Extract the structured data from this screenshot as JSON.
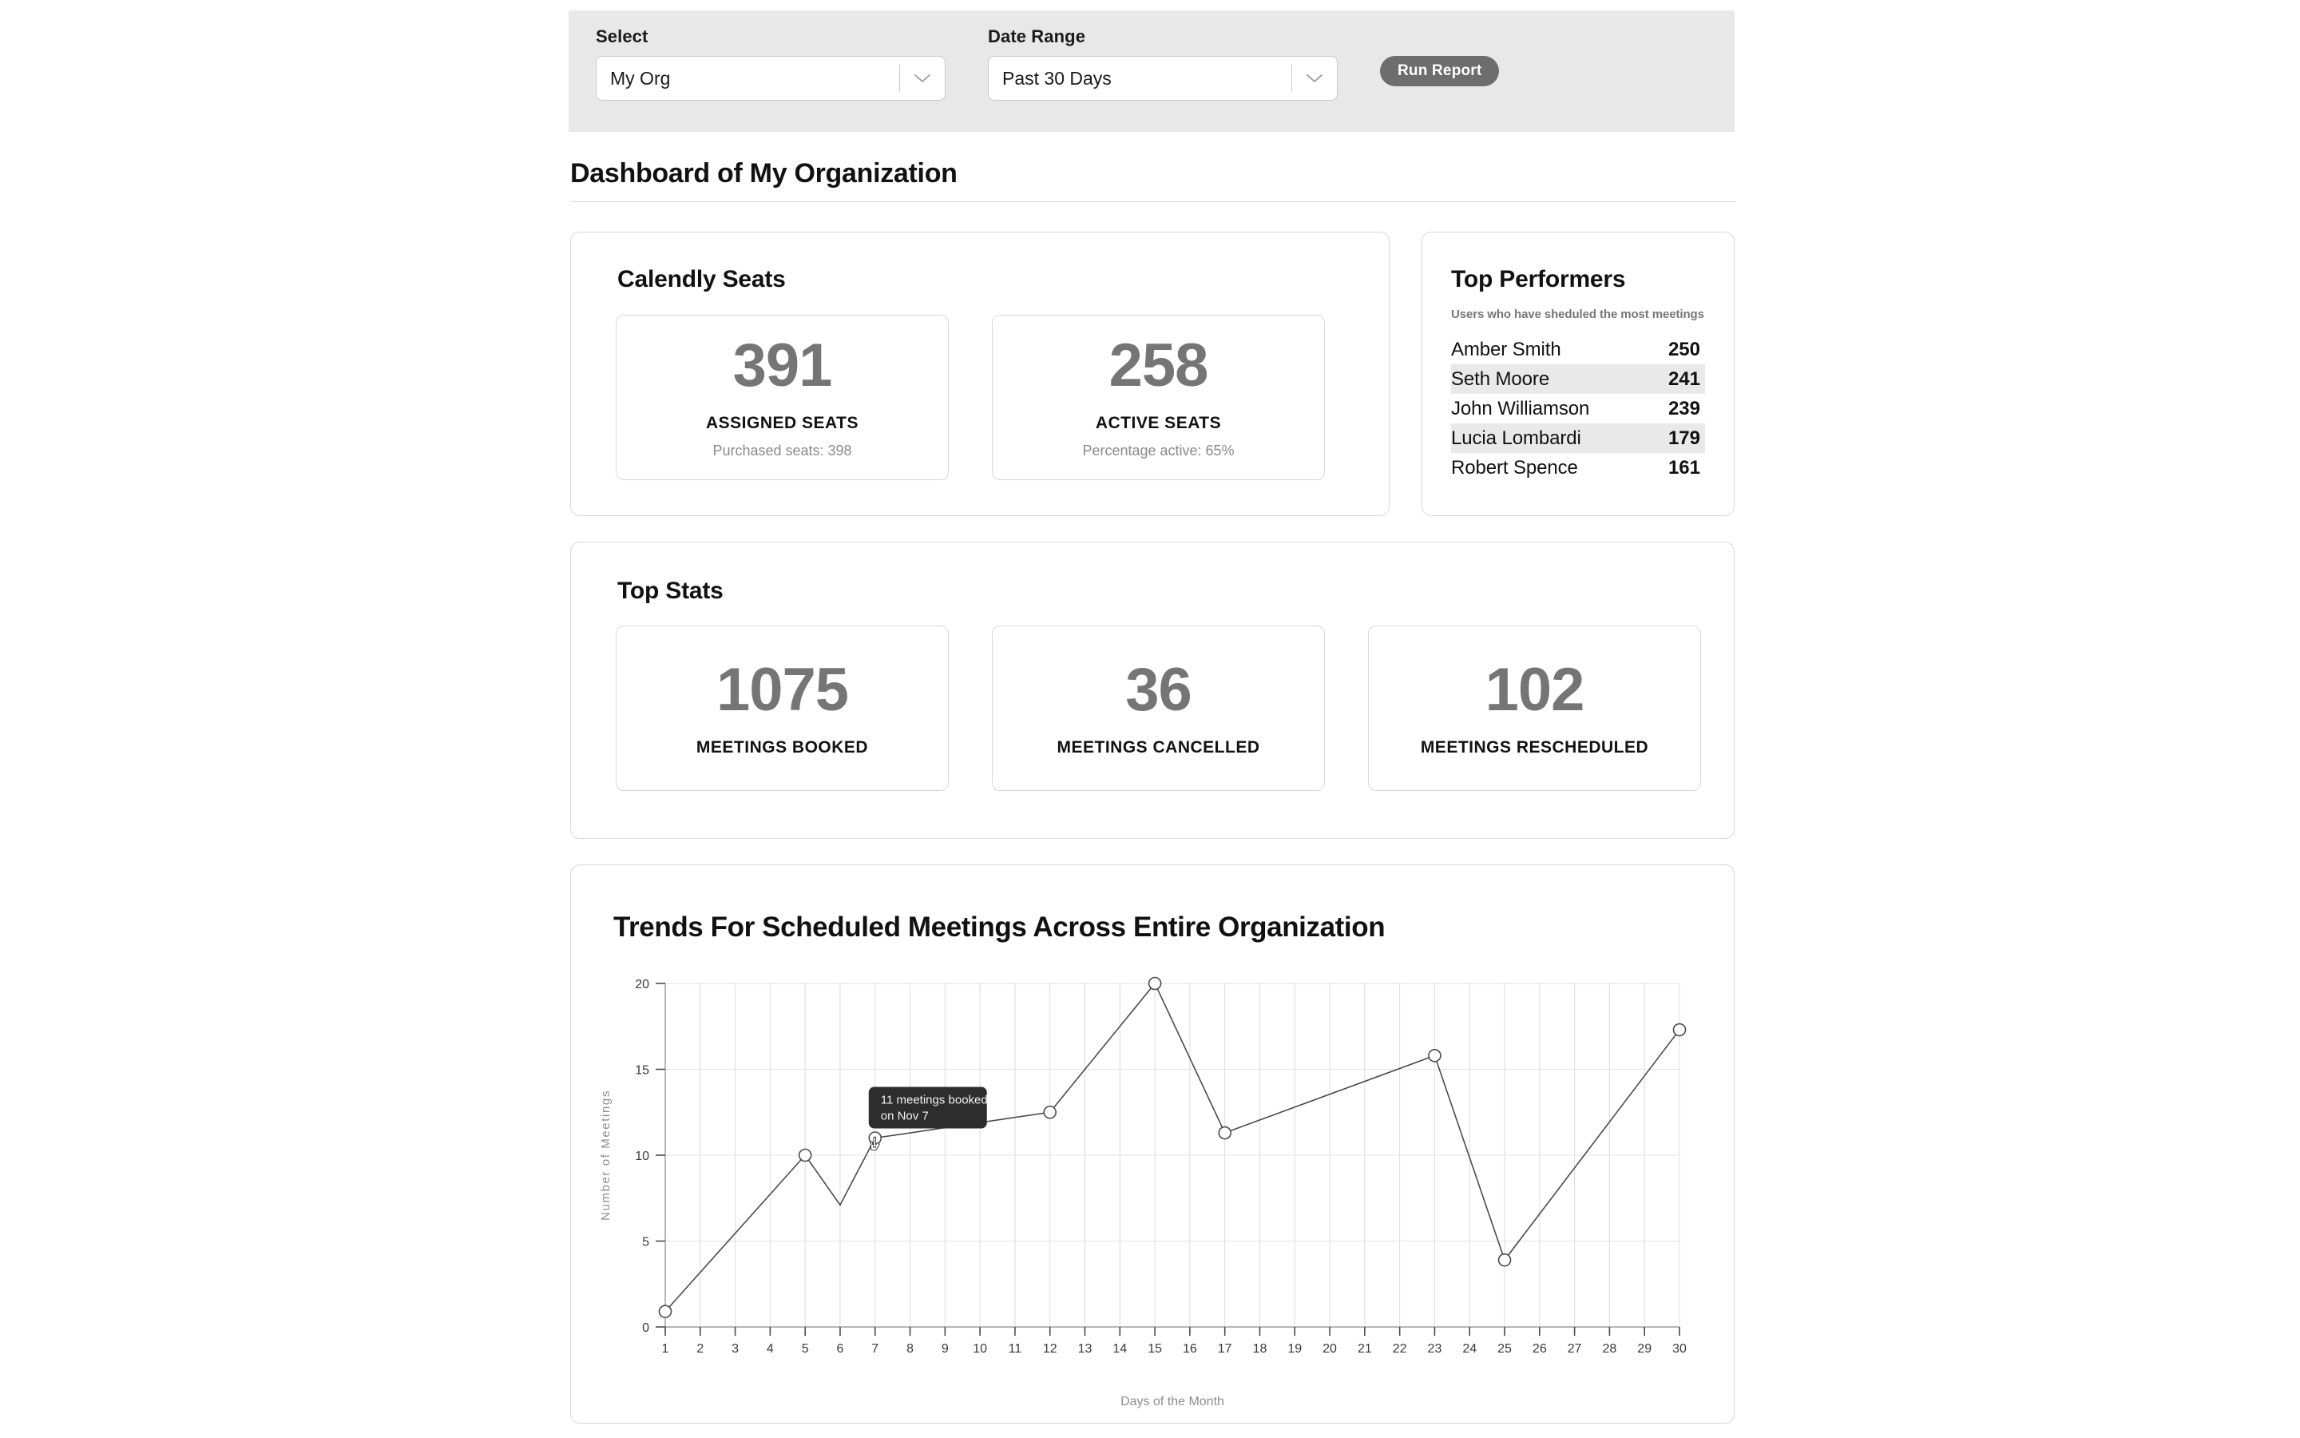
{
  "toolbar": {
    "select_label": "Select",
    "select_value": "My Org",
    "date_label": "Date Range",
    "date_value": "Past 30 Days",
    "run_button": "Run Report",
    "background": "#e8e8e8",
    "button_color": "#6d6d6d"
  },
  "header": {
    "title": "Dashboard of My Organization"
  },
  "seats_card": {
    "title": "Calendly Seats",
    "stats": [
      {
        "value": "391",
        "caption": "ASSIGNED SEATS",
        "sub": "Purchased seats: 398"
      },
      {
        "value": "258",
        "caption": "ACTIVE SEATS",
        "sub": "Percentage active: 65%"
      }
    ]
  },
  "performers_card": {
    "title": "Top Performers",
    "subtitle": "Users who have sheduled the most meetings",
    "rows": [
      {
        "name": "Amber Smith",
        "score": "250"
      },
      {
        "name": "Seth Moore",
        "score": "241"
      },
      {
        "name": "John Williamson",
        "score": "239"
      },
      {
        "name": "Lucia Lombardi",
        "score": "179"
      },
      {
        "name": "Robert Spence",
        "score": "161"
      }
    ]
  },
  "stats_card": {
    "title": "Top Stats",
    "stats": [
      {
        "value": "1075",
        "caption": "MEETINGS BOOKED"
      },
      {
        "value": "36",
        "caption": "MEETINGS CANCELLED"
      },
      {
        "value": "102",
        "caption": "MEETINGS RESCHEDULED"
      }
    ]
  },
  "chart_card": {
    "title": "Trends For Scheduled Meetings Across Entire Organization",
    "tooltip": {
      "line1": "11 meetings booked",
      "line2": "on Nov 7",
      "background": "#2d2d2d",
      "anchor_day": 7
    },
    "cursor": "pointing-hand"
  },
  "chart_data": {
    "type": "line",
    "title": "Trends For Scheduled Meetings Across Entire Organization",
    "xlabel": "Days of the Month",
    "ylabel": "Number of Meetings",
    "xticks": [
      1,
      2,
      3,
      4,
      5,
      6,
      7,
      8,
      9,
      10,
      11,
      12,
      13,
      14,
      15,
      16,
      17,
      18,
      19,
      20,
      21,
      22,
      23,
      24,
      25,
      26,
      27,
      28,
      29,
      30
    ],
    "yticks": [
      0,
      5,
      10,
      15,
      20
    ],
    "xlim": [
      1,
      30
    ],
    "ylim": [
      0,
      20
    ],
    "grid": true,
    "legend": "none",
    "line_color": "#4a4a4a",
    "marker": "open-circle",
    "series": [
      {
        "name": "Meetings booked",
        "points": [
          {
            "x": 1,
            "y": 0.9,
            "marker": true
          },
          {
            "x": 5,
            "y": 10.0,
            "marker": true
          },
          {
            "x": 6,
            "y": 7.1,
            "marker": false
          },
          {
            "x": 7,
            "y": 11.0,
            "marker": true
          },
          {
            "x": 12,
            "y": 12.5,
            "marker": true
          },
          {
            "x": 15,
            "y": 20.0,
            "marker": true
          },
          {
            "x": 17,
            "y": 11.3,
            "marker": true
          },
          {
            "x": 23,
            "y": 15.8,
            "marker": true
          },
          {
            "x": 25,
            "y": 3.9,
            "marker": true
          },
          {
            "x": 30,
            "y": 17.3,
            "marker": true
          }
        ]
      }
    ]
  }
}
